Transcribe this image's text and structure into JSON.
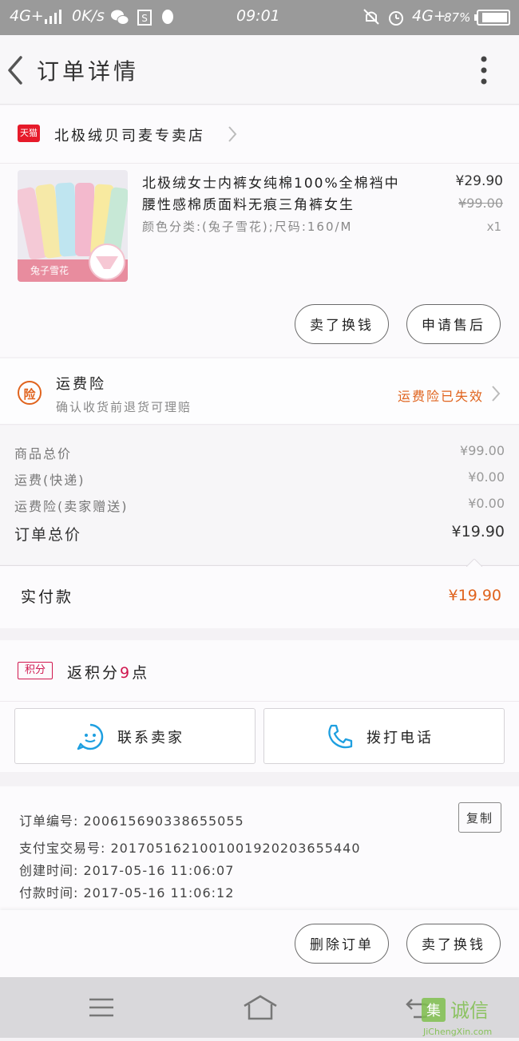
{
  "status_bar": {
    "network": "4G+",
    "speed": "0K/s",
    "time": "09:01",
    "network_right": "4G+",
    "battery": "87%"
  },
  "header": {
    "title": "订单详情"
  },
  "shop": {
    "badge": "天猫",
    "name": "北极绒贝司麦专卖店"
  },
  "product": {
    "title": "北极绒女士内裤女纯棉100%全棉裆中腰性感棉质面料无痕三角裤女生",
    "sku": "颜色分类:(兔子雪花);尺码:160/M",
    "price": "¥29.90",
    "original_price": "¥99.00",
    "quantity": "x1",
    "thumb_caption": "兔子雪花",
    "buttons": {
      "exchange": "卖了换钱",
      "after_sale": "申请售后"
    }
  },
  "insurance": {
    "icon_label": "险",
    "title": "运费险",
    "desc": "确认收货前退货可理赔",
    "status": "运费险已失效"
  },
  "costs": [
    {
      "label": "商品总价",
      "value": "¥99.00"
    },
    {
      "label": "运费(快递)",
      "value": "¥0.00"
    },
    {
      "label": "运费险(卖家赠送)",
      "value": "¥0.00"
    }
  ],
  "order_total": {
    "label": "订单总价",
    "value": "¥19.90"
  },
  "paid": {
    "label": "实付款",
    "value": "¥19.90"
  },
  "points": {
    "badge": "积分",
    "prefix": "返积分",
    "count": "9",
    "suffix": "点"
  },
  "contact": {
    "seller": "联系卖家",
    "phone": "拨打电话"
  },
  "order_info": {
    "order_no": "订单编号: 200615690338655055",
    "alipay_no": "支付宝交易号: 2017051621001001920203655440",
    "created": "创建时间: 2017-05-16 11:06:07",
    "paid": "付款时间: 2017-05-16 11:06:12",
    "copy_label": "复制"
  },
  "bottom_actions": {
    "delete": "删除订单",
    "resell": "卖了换钱"
  },
  "watermark": {
    "text": "诚信",
    "domain": "JiChengXin.com"
  },
  "colors": {
    "accent_orange": "#e0631d",
    "tmall_red": "#e61a2a",
    "points_pink": "#d0174f",
    "contact_blue": "#1e9fe0"
  }
}
